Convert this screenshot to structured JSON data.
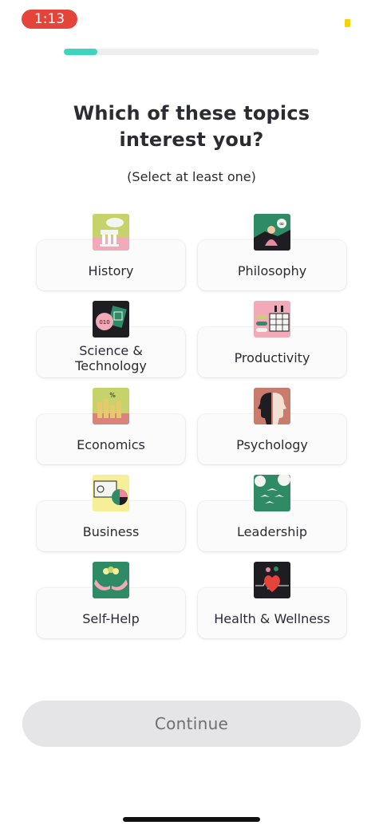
{
  "status_bar": {
    "time": "1:13"
  },
  "progress": {
    "fraction": 0.13
  },
  "header": {
    "title": "Which of these topics\ninterest you?",
    "subtitle": "(Select at least one)"
  },
  "topics": [
    {
      "label": "History",
      "icon": "history-column-icon"
    },
    {
      "label": "Philosophy",
      "icon": "philosophy-thinker-icon"
    },
    {
      "label": "Science &\nTechnology",
      "icon": "science-chip-icon"
    },
    {
      "label": "Productivity",
      "icon": "productivity-calendar-icon"
    },
    {
      "label": "Economics",
      "icon": "economics-coins-icon"
    },
    {
      "label": "Psychology",
      "icon": "psychology-heads-icon"
    },
    {
      "label": "Business",
      "icon": "business-pie-chart-icon"
    },
    {
      "label": "Leadership",
      "icon": "leadership-birds-icon"
    },
    {
      "label": "Self-Help",
      "icon": "self-help-hands-icon"
    },
    {
      "label": "Health & Wellness",
      "icon": "health-heart-icon"
    }
  ],
  "footer": {
    "continue_label": "Continue"
  },
  "colors": {
    "accent": "#3ed5c0",
    "time_pill": "#e5443b",
    "button_disabled": "#e5e5e7"
  }
}
